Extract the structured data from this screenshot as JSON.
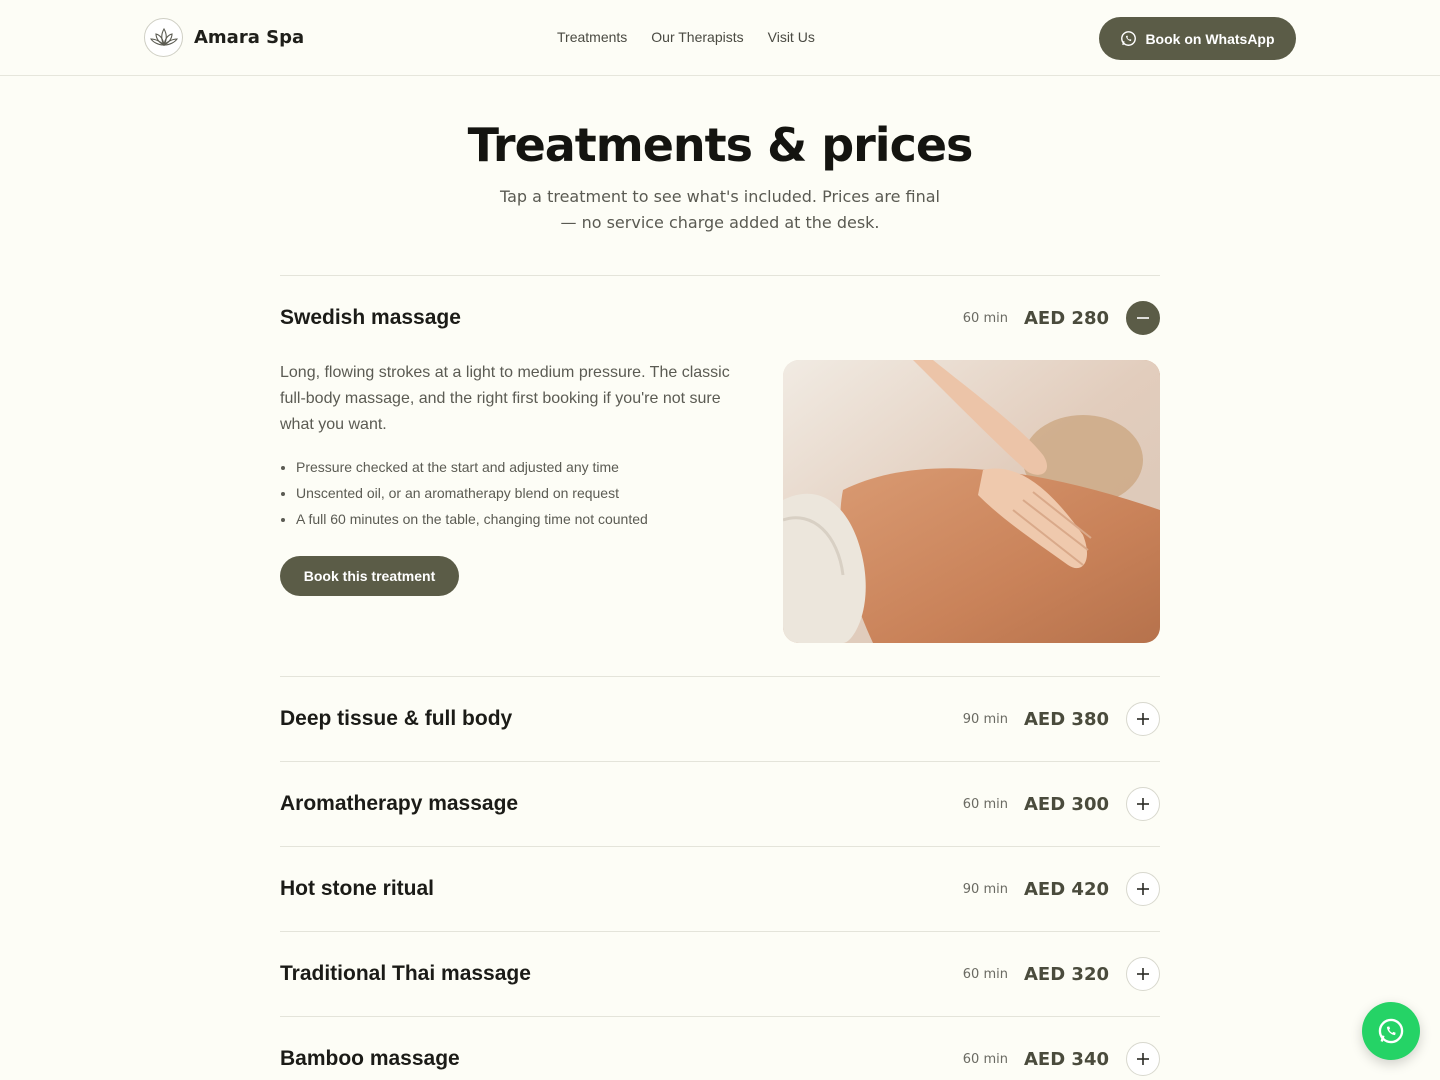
{
  "header": {
    "brand": "Amara Spa",
    "nav": [
      "Treatments",
      "Our Therapists",
      "Visit Us"
    ],
    "cta": "Book on WhatsApp"
  },
  "hero": {
    "title": "Treatments & prices",
    "subtitle": "Tap a treatment to see what's included. Prices are final — no service charge added at the desk."
  },
  "treatments": [
    {
      "name": "Swedish massage",
      "duration": "60 min",
      "price": "AED 280",
      "open": true,
      "description": "Long, flowing strokes at a light to medium pressure. The classic full-body massage, and the right first booking if you're not sure what you want.",
      "features": [
        "Pressure checked at the start and adjusted any time",
        "Unscented oil, or an aromatherapy blend on request",
        "A full 60 minutes on the table, changing time not counted"
      ],
      "book_label": "Book this treatment"
    },
    {
      "name": "Deep tissue & full body",
      "duration": "90 min",
      "price": "AED 380",
      "open": false
    },
    {
      "name": "Aromatherapy massage",
      "duration": "60 min",
      "price": "AED 300",
      "open": false
    },
    {
      "name": "Hot stone ritual",
      "duration": "90 min",
      "price": "AED 420",
      "open": false
    },
    {
      "name": "Traditional Thai massage",
      "duration": "60 min",
      "price": "AED 320",
      "open": false
    },
    {
      "name": "Bamboo massage",
      "duration": "60 min",
      "price": "AED 340",
      "open": false
    }
  ],
  "colors": {
    "accent": "#5b5c47",
    "background": "#fdfdf6",
    "whatsapp": "#25d366"
  },
  "icons": {
    "logo": "lotus-icon",
    "whatsapp": "whatsapp-icon",
    "collapse": "minus-icon",
    "expand": "plus-icon"
  }
}
